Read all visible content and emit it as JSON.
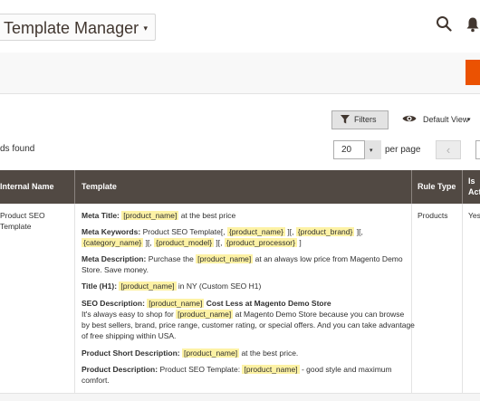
{
  "header": {
    "switcher_label": "Template Manager",
    "switcher_caret": "▾"
  },
  "toolbar": {
    "filters_label": "Filters",
    "view_label": "Default View",
    "view_caret": "▾",
    "records_text": "ds found",
    "per_page_value": "20",
    "per_page_caret": "▾",
    "per_page_label": "per page",
    "prev_glyph": "‹"
  },
  "table": {
    "columns": [
      "Internal Name",
      "Template",
      "Rule Type",
      "Is",
      "Act"
    ],
    "row": {
      "internal_name": [
        "Product SEO",
        "Template"
      ],
      "rule_type": "Products",
      "is_active": "Yes",
      "template": {
        "meta_title_label": "Meta Title:",
        "meta_title_token": "[product_name]",
        "meta_title_rest": "at the best price",
        "meta_keywords_label": "Meta Keywords:",
        "meta_keywords_text": "Product SEO Template[,",
        "mk_token1": "{product_name}",
        "mk_sep1": "][,",
        "mk_token2": "{product_brand}",
        "mk_sep2": "][,",
        "mk_token3": "{category_name}",
        "mk_sep3": "][,",
        "mk_token4": "{product_model}",
        "mk_sep4": "][,",
        "mk_token5": "{product_processor}",
        "mk_end": "]",
        "meta_desc_label": "Meta Description:",
        "meta_desc_pre": "Purchase the",
        "meta_desc_token": "[product_name]",
        "meta_desc_post": "at an always low price from Magento Demo",
        "meta_desc_line2": "Store. Save money.",
        "h1_label": "Title (H1):",
        "h1_token": "[product_name]",
        "h1_rest": "in NY (Custom SEO H1)",
        "seo_desc_label": "SEO Description:",
        "seo_desc_token": "[product_name]",
        "seo_desc_bold": "Cost Less at Magento Demo Store",
        "seo_line2_pre": "It's always easy to shop for",
        "seo_line2_token": "[product_name]",
        "seo_line2_post": "at Magento Demo Store because you can browse",
        "seo_line3": "by best sellers, brand, price range, customer rating, or special offers. And you can take advantage",
        "seo_line4": "of free shipping within USA.",
        "short_desc_label": "Product Short Description:",
        "short_desc_token": "[product_name]",
        "short_desc_rest": "at the best price.",
        "desc_label": "Product Description:",
        "desc_pre": "Product SEO Template:",
        "desc_token": "[product_name]",
        "desc_post": "- good style and maximum",
        "desc_line2": "comfort."
      }
    }
  },
  "icons": {
    "search": "search-icon",
    "bell": "bell-icon",
    "filter": "filter-icon",
    "eye": "eye-icon"
  },
  "colors": {
    "accent": "#eb5202",
    "table_header": "#514943",
    "highlight": "#fdf2a5"
  }
}
